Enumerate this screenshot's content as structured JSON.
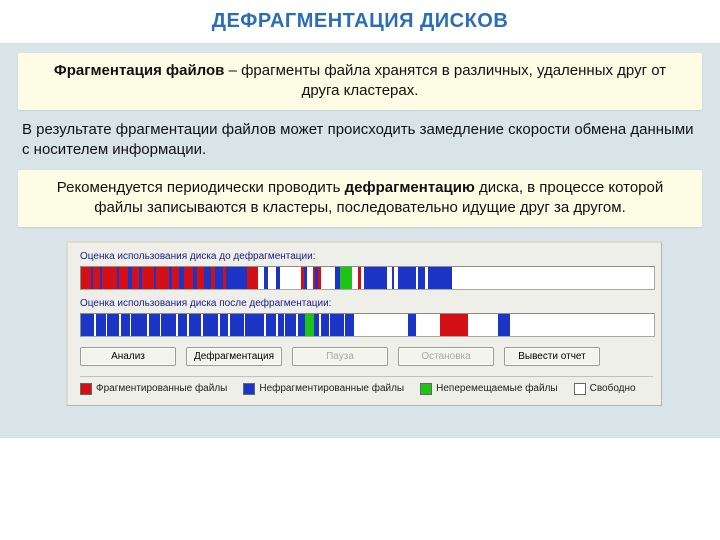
{
  "title": "ДЕФРАГМЕНТАЦИЯ ДИСКОВ",
  "frag_card": {
    "bold": "Фрагментация файлов",
    "rest": " – фрагменты файла хранятся в различных, удаленных друг от друга кластерах."
  },
  "mid_para": "В результате фрагментации файлов может происходить замедление скорости обмена данными с носителем информации.",
  "defrag_card": {
    "pre": "Рекомендуется периодически проводить ",
    "bold": "дефрагментацию",
    "post": " диска, в процессе которой файлы записываются в кластеры, последовательно идущие друг за другом."
  },
  "window": {
    "label_before": "Оценка использования диска до дефрагментации:",
    "label_after": "Оценка использования диска после дефрагментации:",
    "buttons": {
      "analyze": "Анализ",
      "defrag": "Дефрагментация",
      "pause": "Пауза",
      "stop": "Остановка",
      "report": "Вывести отчет"
    },
    "legend": {
      "frag": "Фрагментированные файлы",
      "nonfrag": "Нефрагментированные файлы",
      "immovable": "Неперемещаемые файлы",
      "free": "Свободно"
    },
    "colors": {
      "frag": "#d40f16",
      "nonfrag": "#1c35c6",
      "immovable": "#1ec318",
      "free": "#ffffff"
    },
    "bar_before_segments": [
      {
        "c": "frag",
        "w": 1.6
      },
      {
        "c": "nonfrag",
        "w": 0.4
      },
      {
        "c": "frag",
        "w": 1.1
      },
      {
        "c": "nonfrag",
        "w": 0.3
      },
      {
        "c": "frag",
        "w": 2.5
      },
      {
        "c": "nonfrag",
        "w": 0.4
      },
      {
        "c": "frag",
        "w": 1.4
      },
      {
        "c": "nonfrag",
        "w": 0.7
      },
      {
        "c": "frag",
        "w": 1.2
      },
      {
        "c": "nonfrag",
        "w": 0.5
      },
      {
        "c": "frag",
        "w": 1.9
      },
      {
        "c": "nonfrag",
        "w": 0.3
      },
      {
        "c": "frag",
        "w": 2.1
      },
      {
        "c": "nonfrag",
        "w": 0.6
      },
      {
        "c": "frag",
        "w": 1.2
      },
      {
        "c": "nonfrag",
        "w": 0.7
      },
      {
        "c": "frag",
        "w": 1.6
      },
      {
        "c": "nonfrag",
        "w": 0.6
      },
      {
        "c": "frag",
        "w": 1.2
      },
      {
        "c": "nonfrag",
        "w": 1.1
      },
      {
        "c": "frag",
        "w": 0.7
      },
      {
        "c": "nonfrag",
        "w": 1.3
      },
      {
        "c": "frag",
        "w": 0.5
      },
      {
        "c": "nonfrag",
        "w": 3.4
      },
      {
        "c": "frag",
        "w": 1.8
      },
      {
        "c": "free",
        "w": 1.0
      },
      {
        "c": "nonfrag",
        "w": 0.6
      },
      {
        "c": "free",
        "w": 1.4
      },
      {
        "c": "nonfrag",
        "w": 0.6
      },
      {
        "c": "free",
        "w": 3.5
      },
      {
        "c": "frag",
        "w": 0.4
      },
      {
        "c": "nonfrag",
        "w": 0.6
      },
      {
        "c": "free",
        "w": 1.0
      },
      {
        "c": "frag",
        "w": 0.3
      },
      {
        "c": "nonfrag",
        "w": 0.5
      },
      {
        "c": "frag",
        "w": 0.5
      },
      {
        "c": "free",
        "w": 2.3
      },
      {
        "c": "nonfrag",
        "w": 0.8
      },
      {
        "c": "immovable",
        "w": 2.0
      },
      {
        "c": "free",
        "w": 1.0
      },
      {
        "c": "frag",
        "w": 0.4
      },
      {
        "c": "free",
        "w": 0.5
      },
      {
        "c": "nonfrag",
        "w": 3.8
      },
      {
        "c": "free",
        "w": 0.8
      },
      {
        "c": "nonfrag",
        "w": 0.4
      },
      {
        "c": "free",
        "w": 0.6
      },
      {
        "c": "nonfrag",
        "w": 3.0
      },
      {
        "c": "free",
        "w": 0.4
      },
      {
        "c": "nonfrag",
        "w": 1.0
      },
      {
        "c": "free",
        "w": 0.6
      },
      {
        "c": "nonfrag",
        "w": 4.0
      },
      {
        "c": "free",
        "w": 33.0
      }
    ],
    "bar_after_segments": [
      {
        "c": "nonfrag",
        "w": 2.2
      },
      {
        "c": "free",
        "w": 0.3
      },
      {
        "c": "nonfrag",
        "w": 1.6
      },
      {
        "c": "free",
        "w": 0.3
      },
      {
        "c": "nonfrag",
        "w": 2.0
      },
      {
        "c": "free",
        "w": 0.3
      },
      {
        "c": "nonfrag",
        "w": 1.4
      },
      {
        "c": "free",
        "w": 0.3
      },
      {
        "c": "nonfrag",
        "w": 2.6
      },
      {
        "c": "free",
        "w": 0.3
      },
      {
        "c": "nonfrag",
        "w": 1.8
      },
      {
        "c": "free",
        "w": 0.3
      },
      {
        "c": "nonfrag",
        "w": 2.4
      },
      {
        "c": "free",
        "w": 0.3
      },
      {
        "c": "nonfrag",
        "w": 1.6
      },
      {
        "c": "free",
        "w": 0.3
      },
      {
        "c": "nonfrag",
        "w": 2.0
      },
      {
        "c": "free",
        "w": 0.3
      },
      {
        "c": "nonfrag",
        "w": 2.6
      },
      {
        "c": "free",
        "w": 0.3
      },
      {
        "c": "nonfrag",
        "w": 1.3
      },
      {
        "c": "free",
        "w": 0.3
      },
      {
        "c": "nonfrag",
        "w": 2.3
      },
      {
        "c": "free",
        "w": 0.3
      },
      {
        "c": "nonfrag",
        "w": 3.2
      },
      {
        "c": "free",
        "w": 0.3
      },
      {
        "c": "nonfrag",
        "w": 1.6
      },
      {
        "c": "free",
        "w": 0.3
      },
      {
        "c": "nonfrag",
        "w": 1.0
      },
      {
        "c": "free",
        "w": 0.3
      },
      {
        "c": "nonfrag",
        "w": 1.8
      },
      {
        "c": "free",
        "w": 0.3
      },
      {
        "c": "nonfrag",
        "w": 1.1
      },
      {
        "c": "immovable",
        "w": 1.6
      },
      {
        "c": "nonfrag",
        "w": 0.8
      },
      {
        "c": "free",
        "w": 0.3
      },
      {
        "c": "nonfrag",
        "w": 1.3
      },
      {
        "c": "free",
        "w": 0.3
      },
      {
        "c": "nonfrag",
        "w": 2.2
      },
      {
        "c": "free",
        "w": 0.3
      },
      {
        "c": "nonfrag",
        "w": 1.4
      },
      {
        "c": "free",
        "w": 9.0
      },
      {
        "c": "nonfrag",
        "w": 1.4
      },
      {
        "c": "free",
        "w": 4.0
      },
      {
        "c": "frag",
        "w": 4.6
      },
      {
        "c": "free",
        "w": 5.0
      },
      {
        "c": "nonfrag",
        "w": 2.0
      },
      {
        "c": "free",
        "w": 24.0
      }
    ]
  }
}
